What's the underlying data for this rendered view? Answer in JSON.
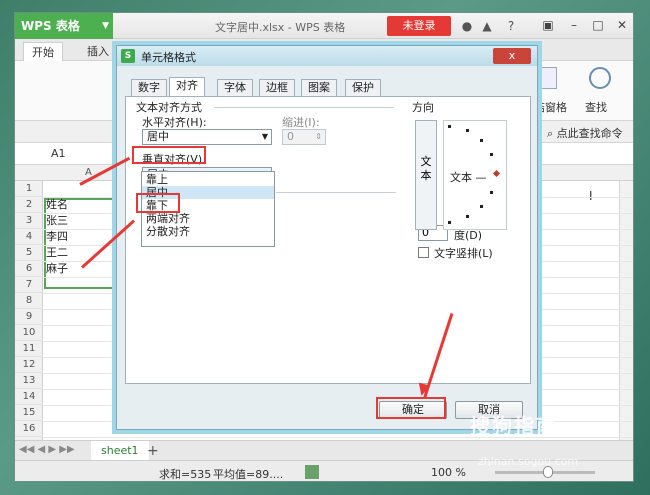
{
  "app": {
    "name": "WPS 表格",
    "doc_title": "文字居中.xlsx - WPS 表格",
    "login": "未登录"
  },
  "ribbon": {
    "tabs": [
      "开始",
      "插入"
    ],
    "right_items": [
      "冻结窗格",
      "查找"
    ],
    "search_label": "点此查找命令"
  },
  "formula": {
    "namebox": "A1"
  },
  "sheet": {
    "col_letter": "A",
    "row_numbers": [
      "1",
      "2",
      "3",
      "4",
      "5",
      "6",
      "7",
      "8",
      "9",
      "10",
      "11",
      "12",
      "13",
      "14",
      "15",
      "16"
    ],
    "cells": [
      "",
      "姓名",
      "张三",
      "李四",
      "王二",
      "麻子"
    ],
    "tab_name": "sheet1",
    "cursor_char": "I"
  },
  "status": {
    "sum": "求和=535",
    "avg": "平均值=89....",
    "zoom": "100 %"
  },
  "dialog": {
    "title": "单元格格式",
    "close": "x",
    "tabs": [
      "数字",
      "对齐",
      "字体",
      "边框",
      "图案",
      "保护"
    ],
    "active_tab": "对齐",
    "section_text_align": "文本对齐方式",
    "h_align_label": "水平对齐(H):",
    "h_align_value": "居中",
    "indent_label": "缩进(I):",
    "indent_value": "0",
    "v_align_label": "垂直对齐(V)",
    "v_align_value": "居中",
    "v_align_options": [
      "靠上",
      "居中",
      "靠下",
      "两端对齐",
      "分散对齐"
    ],
    "v_align_selected_index": 1,
    "orientation_label": "方向",
    "vertical_text": "文本",
    "dial_text": "文本 —",
    "degree_value": "0",
    "degree_label": "度(D)",
    "vertical_text_checkbox": "文字竖排(L)",
    "ok": "确定",
    "cancel": "取消"
  },
  "watermark": {
    "brand": "搜狗指南",
    "url": "zhinan.sogou.com"
  },
  "colors": {
    "accent_green": "#4caf50",
    "highlight_red": "#e53935",
    "dialog_glow": "#9fd6e8"
  }
}
